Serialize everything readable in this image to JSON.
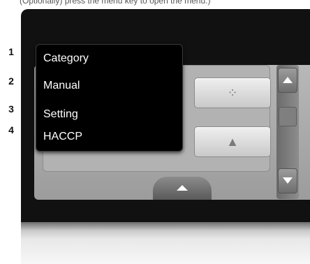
{
  "caption": "(Optionally) press the menu key to open the menu.)",
  "margin_numbers": [
    "1",
    "2",
    "3",
    "4"
  ],
  "menu": {
    "items": [
      {
        "label": "Category"
      },
      {
        "label": "Manual"
      },
      {
        "label": "Setting"
      },
      {
        "label": "HACCP"
      }
    ]
  },
  "tiles": [
    {
      "icon": "ribs-icon",
      "glyph": "⁘"
    },
    {
      "icon": "cake-slice-icon",
      "glyph": "▲"
    }
  ],
  "colors": {
    "device_body": "#111111",
    "screen": "#a8a8a8",
    "menu_bg": "#000000",
    "menu_text": "#ffffff"
  }
}
